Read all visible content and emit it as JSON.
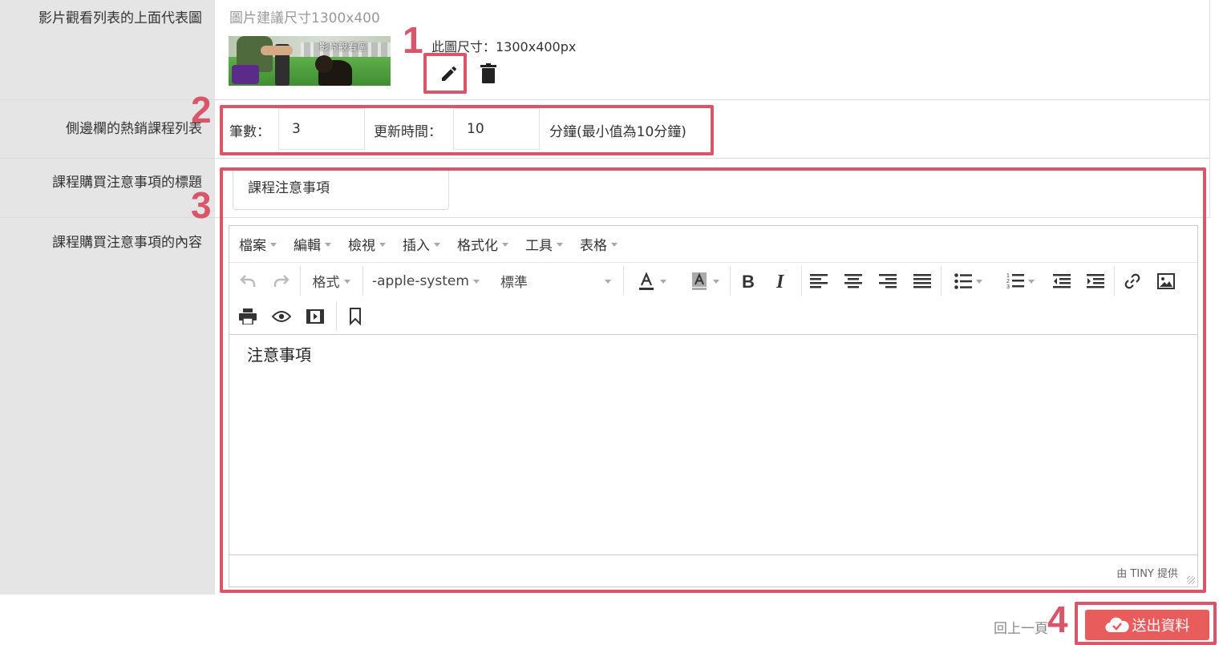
{
  "form": {
    "row1": {
      "label": "影片觀看列表的上面代表圖",
      "hint": "圖片建議尺寸1300x400",
      "thumbnail_text": "影片觀看區",
      "size_text": "此圖尺寸：1300x400px",
      "edit_icon": "pencil-icon",
      "delete_icon": "trash-icon"
    },
    "row2": {
      "label": "側邊欄的熱銷課程列表",
      "count_label": "筆數：",
      "count_value": "3",
      "update_label": "更新時間：",
      "update_value": "10",
      "unit_note": "分鐘(最小值為10分鐘)"
    },
    "row3": {
      "label": "課程購買注意事項的標題",
      "title_value": "課程注意事項"
    },
    "row4": {
      "label": "課程購買注意事項的內容"
    }
  },
  "editor": {
    "menus": [
      "檔案",
      "編輯",
      "檢視",
      "插入",
      "格式化",
      "工具",
      "表格"
    ],
    "format_label": "格式",
    "font_family": "-apple-system",
    "font_size": "標準",
    "content": "注意事項",
    "powered_by": "由 TINY 提供"
  },
  "annotations": [
    "1",
    "2",
    "3",
    "4"
  ],
  "footer": {
    "back_label": "回上一頁",
    "submit_label": "送出資料",
    "submit_icon": "cloud-check-icon"
  },
  "colors": {
    "annotation": "#d9566a",
    "submit": "#e95c5c",
    "label_bg": "#e5e5e5"
  }
}
